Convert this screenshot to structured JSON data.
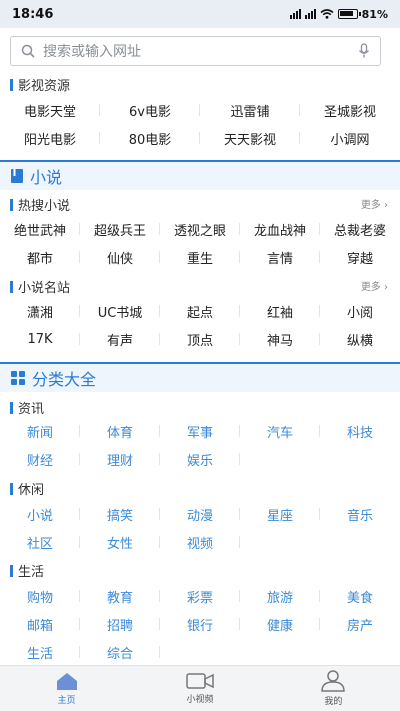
{
  "status": {
    "time": "18:46",
    "battery": "81%"
  },
  "search": {
    "placeholder": "搜索或输入网址"
  },
  "video": {
    "title": "影视资源",
    "items": [
      "电影天堂",
      "6v电影",
      "迅雷铺",
      "圣城影视",
      "阳光电影",
      "80电影",
      "天天影视",
      "小调网"
    ]
  },
  "novel": {
    "title": "小说",
    "hot": {
      "title": "热搜小说",
      "more": "更多",
      "items": [
        "绝世武神",
        "超级兵王",
        "透视之眼",
        "龙血战神",
        "总裁老婆",
        "都市",
        "仙侠",
        "重生",
        "言情",
        "穿越"
      ]
    },
    "sites": {
      "title": "小说名站",
      "more": "更多",
      "items": [
        "潇湘",
        "UC书城",
        "起点",
        "红袖",
        "小阅",
        "17K",
        "有声",
        "顶点",
        "神马",
        "纵横"
      ]
    }
  },
  "category": {
    "title": "分类大全",
    "groups": [
      {
        "title": "资讯",
        "items": [
          "新闻",
          "体育",
          "军事",
          "汽车",
          "科技",
          "财经",
          "理财",
          "娱乐"
        ]
      },
      {
        "title": "休闲",
        "items": [
          "小说",
          "搞笑",
          "动漫",
          "星座",
          "音乐",
          "社区",
          "女性",
          "视频"
        ]
      },
      {
        "title": "生活",
        "items": [
          "购物",
          "教育",
          "彩票",
          "旅游",
          "美食",
          "邮箱",
          "招聘",
          "银行",
          "健康",
          "房产",
          "生活",
          "综合"
        ]
      }
    ]
  },
  "tabs": [
    {
      "label": "主页",
      "icon": "home-icon"
    },
    {
      "label": "小视频",
      "icon": "video-camera-icon"
    },
    {
      "label": "我的",
      "icon": "user-icon"
    }
  ],
  "colors": {
    "accent": "#2b7bd6",
    "link": "#3b8ad8"
  }
}
